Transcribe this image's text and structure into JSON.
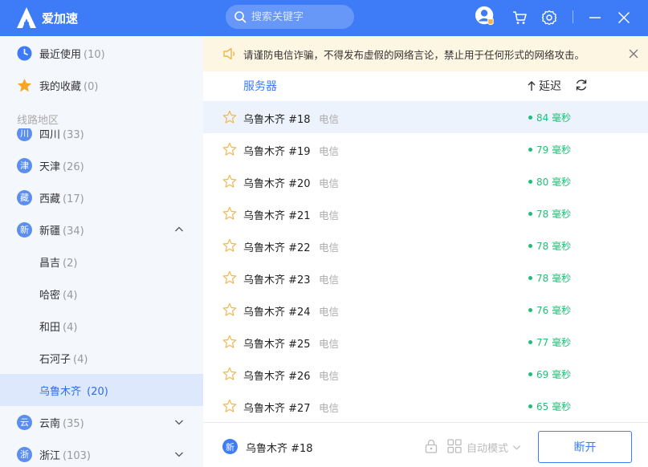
{
  "app": {
    "title": "爱加速"
  },
  "search": {
    "placeholder": "搜索关键字"
  },
  "sidebar": {
    "recent": {
      "label": "最近使用",
      "count": "(10)"
    },
    "favorites": {
      "label": "我的收藏",
      "count": "(0)"
    },
    "section_title": "线路地区",
    "regions": [
      {
        "badge": "川",
        "label": "四川",
        "count": "(33)"
      },
      {
        "badge": "津",
        "label": "天津",
        "count": "(26)"
      },
      {
        "badge": "藏",
        "label": "西藏",
        "count": "(17)"
      },
      {
        "badge": "新",
        "label": "新疆",
        "count": "(34)"
      }
    ],
    "sub_regions": [
      {
        "label": "昌吉",
        "count": "(2)"
      },
      {
        "label": "哈密",
        "count": "(4)"
      },
      {
        "label": "和田",
        "count": "(4)"
      },
      {
        "label": "石河子",
        "count": "(4)"
      },
      {
        "label": "乌鲁木齐",
        "count": "(20)"
      }
    ],
    "more_regions": [
      {
        "badge": "云",
        "label": "云南",
        "count": "(35)"
      },
      {
        "badge": "浙",
        "label": "浙江",
        "count": "(103)"
      }
    ]
  },
  "notice": {
    "text": "请谨防电信诈骗，不得发布虚假的网络言论，禁止用于任何形式的网络攻击。"
  },
  "list_header": {
    "server": "服务器",
    "latency": "延迟"
  },
  "servers": [
    {
      "name": "乌鲁木齐 #18",
      "isp": "电信",
      "latency": "84 毫秒"
    },
    {
      "name": "乌鲁木齐 #19",
      "isp": "电信",
      "latency": "79 毫秒"
    },
    {
      "name": "乌鲁木齐 #20",
      "isp": "电信",
      "latency": "80 毫秒"
    },
    {
      "name": "乌鲁木齐 #21",
      "isp": "电信",
      "latency": "78 毫秒"
    },
    {
      "name": "乌鲁木齐 #22",
      "isp": "电信",
      "latency": "78 毫秒"
    },
    {
      "name": "乌鲁木齐 #23",
      "isp": "电信",
      "latency": "78 毫秒"
    },
    {
      "name": "乌鲁木齐 #24",
      "isp": "电信",
      "latency": "76 毫秒"
    },
    {
      "name": "乌鲁木齐 #25",
      "isp": "电信",
      "latency": "77 毫秒"
    },
    {
      "name": "乌鲁木齐 #26",
      "isp": "电信",
      "latency": "69 毫秒"
    },
    {
      "name": "乌鲁木齐 #27",
      "isp": "电信",
      "latency": "65 毫秒"
    }
  ],
  "footer": {
    "badge": "新",
    "current_server": "乌鲁木齐 #18",
    "mode": "自动模式",
    "disconnect": "断开"
  },
  "colors": {
    "accent": "#3d7bf7",
    "latency_green": "#1fbf75",
    "notice_bg": "#fdf6e3",
    "star": "#f0b64a"
  }
}
